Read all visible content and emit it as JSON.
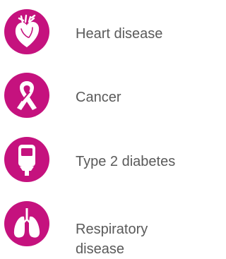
{
  "accent_color": "#c5127e",
  "text_color": "#5a5a5a",
  "items": [
    {
      "icon": "heart-icon",
      "label": "Heart disease"
    },
    {
      "icon": "ribbon-icon",
      "label": "Cancer"
    },
    {
      "icon": "glucose-meter-icon",
      "label": "Type 2 diabetes"
    },
    {
      "icon": "lungs-icon",
      "label": "Respiratory disease"
    }
  ]
}
